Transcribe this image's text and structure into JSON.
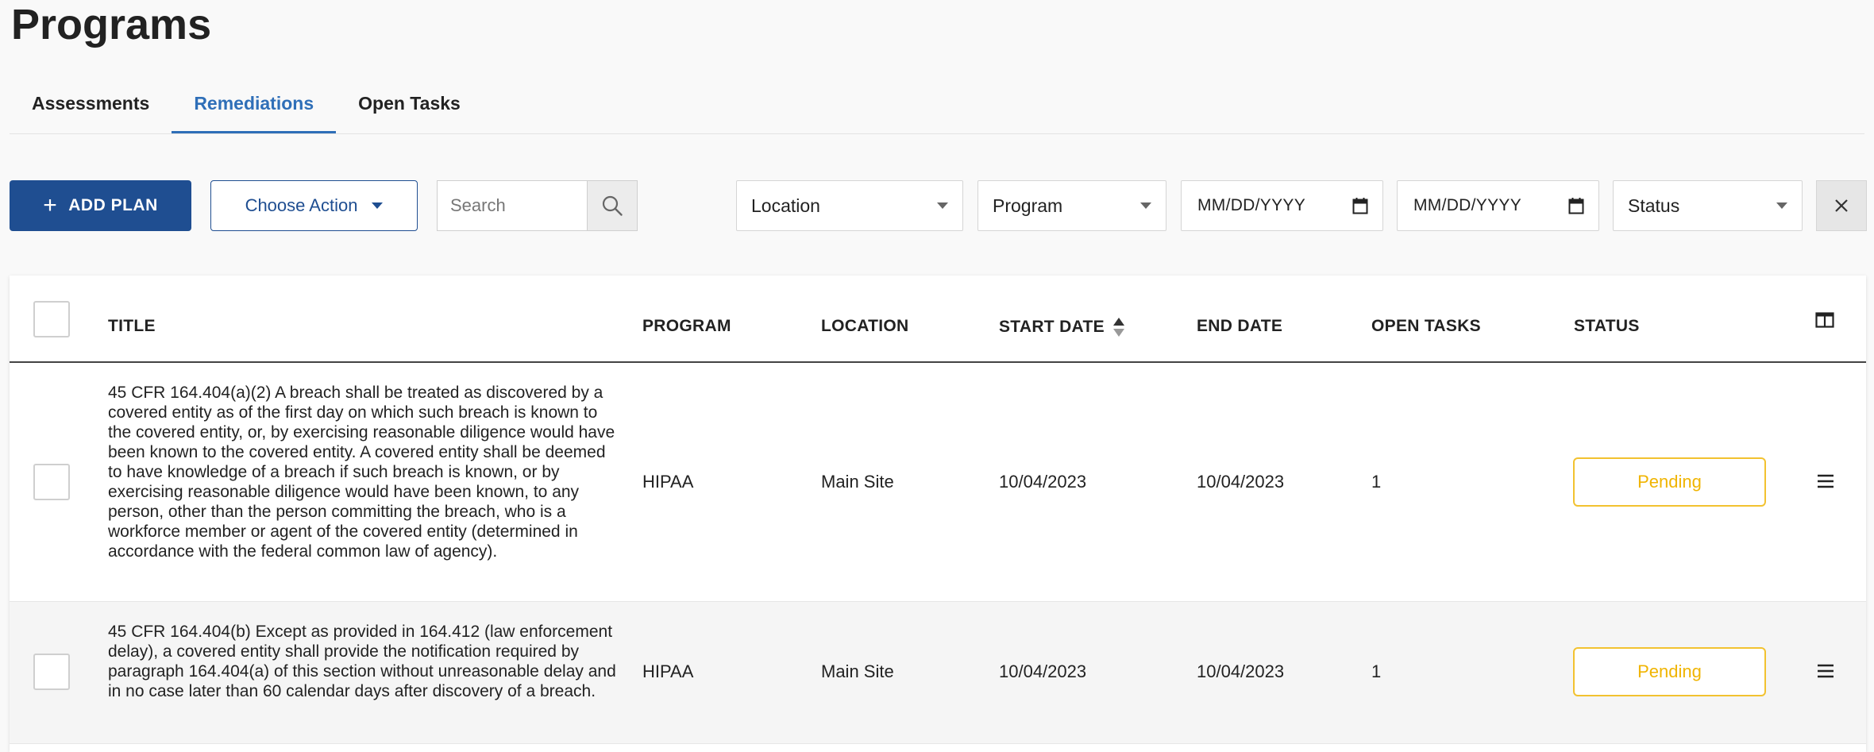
{
  "page": {
    "title": "Programs"
  },
  "tabs": [
    {
      "label": "Assessments",
      "active": false
    },
    {
      "label": "Remediations",
      "active": true
    },
    {
      "label": "Open Tasks",
      "active": false
    }
  ],
  "toolbar": {
    "add_plan_label": "ADD PLAN",
    "choose_action_label": "Choose Action",
    "search_placeholder": "Search",
    "location_label": "Location",
    "program_label": "Program",
    "start_date_placeholder": "MM/DD/YYYY",
    "end_date_placeholder": "MM/DD/YYYY",
    "status_label": "Status"
  },
  "table": {
    "columns": {
      "title": "TITLE",
      "program": "PROGRAM",
      "location": "LOCATION",
      "start_date": "START DATE",
      "end_date": "END DATE",
      "open_tasks": "OPEN TASKS",
      "status": "STATUS"
    },
    "rows": [
      {
        "title": "45 CFR 164.404(a)(2) A breach shall be treated as discovered by a covered entity as of the first day on which such breach is known to the covered entity, or, by exercising reasonable diligence would have been known to the covered entity. A covered entity shall be deemed to have knowledge of a breach if such breach is known, or by exercising reasonable diligence would have been known, to any person, other than the person committing the breach, who is a workforce member or agent of the covered entity (determined in accordance with the federal common law of agency).",
        "program": "HIPAA",
        "location": "Main Site",
        "start_date": "10/04/2023",
        "end_date": "10/04/2023",
        "open_tasks": "1",
        "status": "Pending"
      },
      {
        "title": "45 CFR 164.404(b) Except as provided in 164.412 (law enforcement delay), a covered entity shall provide the notification required by paragraph 164.404(a) of this section without unreasonable delay and in no case later than 60 calendar days after discovery of a breach.",
        "program": "HIPAA",
        "location": "Main Site",
        "start_date": "10/04/2023",
        "end_date": "10/04/2023",
        "open_tasks": "1",
        "status": "Pending"
      }
    ]
  },
  "colors": {
    "primary": "#1f4e91",
    "active_tab": "#2f6fb8",
    "pending": "#f2c230"
  },
  "icons": {
    "add": "plus-icon",
    "search": "search-icon",
    "calendar": "calendar-icon",
    "clear": "close-icon",
    "columns": "columns-icon",
    "row_menu": "hamburger-menu-icon",
    "sort": "sort-icon"
  }
}
